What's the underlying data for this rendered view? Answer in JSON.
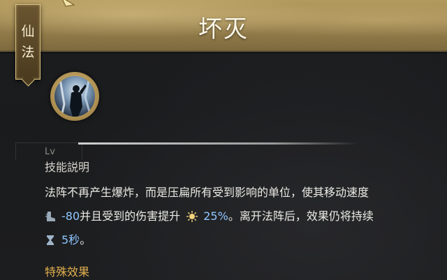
{
  "category_tab": {
    "chars": [
      "仙",
      "法"
    ]
  },
  "title": "坏灭",
  "skill_icon": {
    "icon": "skill-figure-icon",
    "label": "Lv"
  },
  "section_heading": "技能説明",
  "description": {
    "line1": "法阵不再产生爆炸，而是压扁所有受到影响的单位，使其移动速度",
    "line2": {
      "boot_icon": "boot-icon",
      "speed_value": "-80",
      "text_a": "并且受到的伤害提升",
      "sun_icon": "sun-icon",
      "damage_value": "25%",
      "text_b": "。离开法阵后，效果仍将持续"
    },
    "line3": {
      "hourglass_icon": "hourglass-icon",
      "duration_value": "5秒",
      "text": "。"
    }
  },
  "special_effects_heading": "特殊效果",
  "colors": {
    "title_bar_gold": "#9c8450",
    "value_blue": "#8fc6ff",
    "special_gold": "#e2b04e",
    "panel_bg": "#1a1b1d"
  }
}
